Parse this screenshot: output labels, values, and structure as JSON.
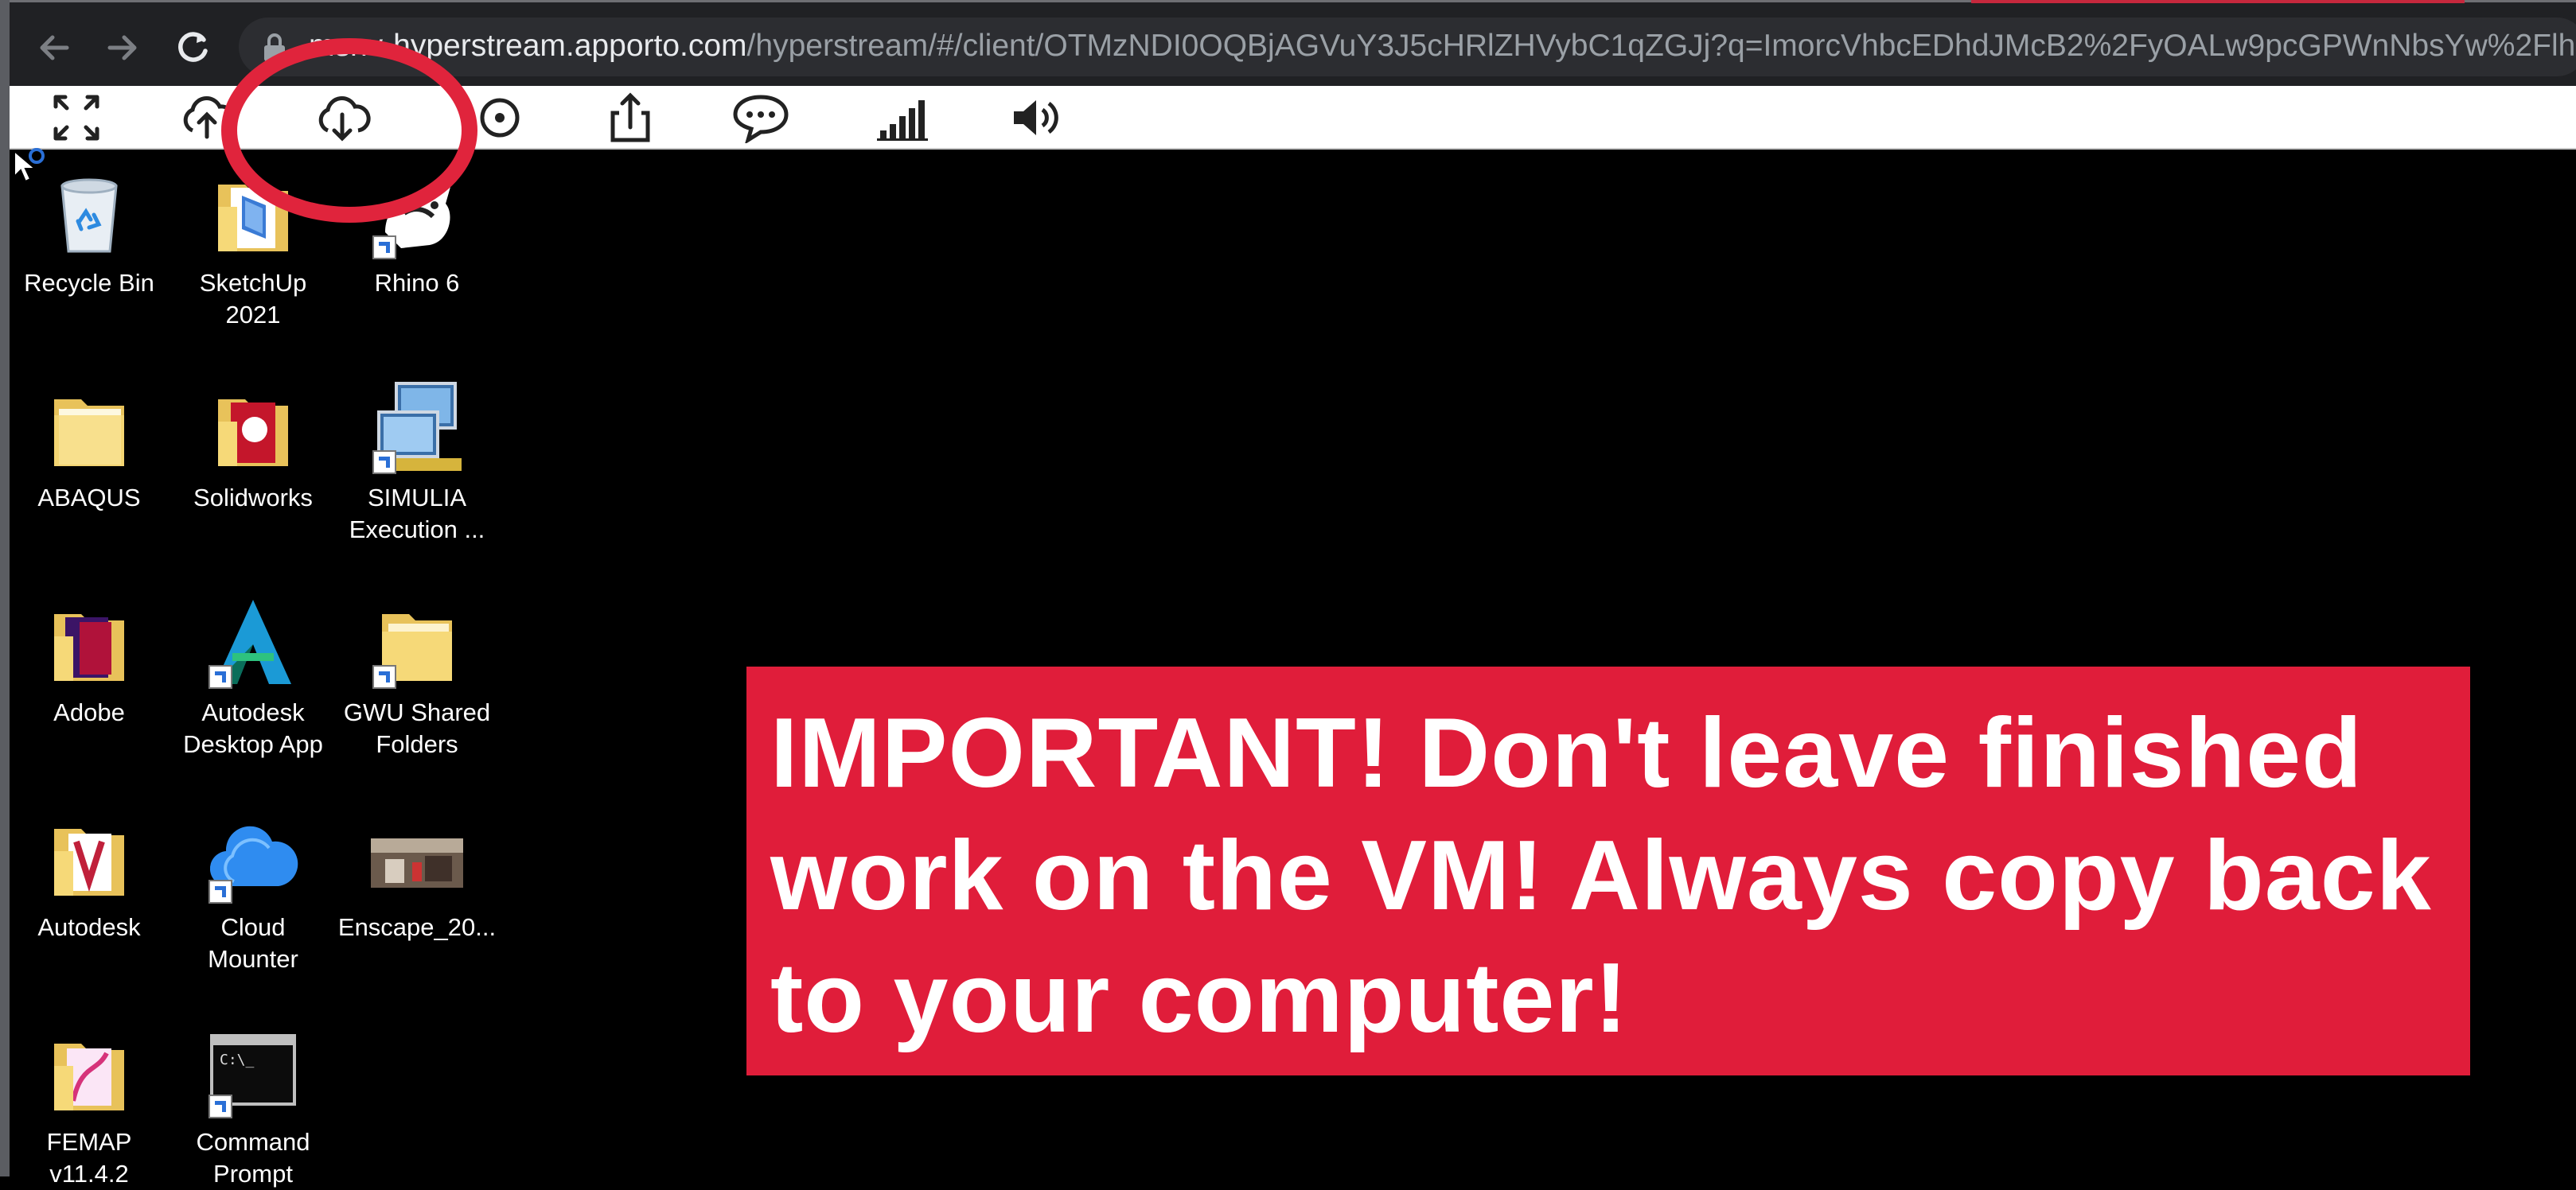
{
  "browser": {
    "url_host": "msnv-hyperstream.apporto.com",
    "url_path": "/hyperstream/#/client/OTMzNDI0OQBjAGVuY3J5cHRlZHVybC1qZGJj?q=ImorcVhbcEDhdJMcB2%2FyOALw9pcGPWnNbsYw%2Flh",
    "nav_icons": [
      "back-arrow-icon",
      "forward-arrow-icon",
      "reload-icon",
      "lock-icon"
    ]
  },
  "toolbar": {
    "icons": [
      "fullscreen-icon",
      "upload-cloud-icon",
      "download-cloud-icon",
      "record-icon",
      "share-icon",
      "chat-icon",
      "signal-icon",
      "volume-icon"
    ]
  },
  "desktop": {
    "icons": [
      {
        "id": "recycle-bin",
        "label": "Recycle Bin",
        "icon": "recycle-bin-icon"
      },
      {
        "id": "sketchup",
        "label": "SketchUp 2021",
        "icon": "sketchup-icon"
      },
      {
        "id": "rhino",
        "label": "Rhino 6",
        "icon": "rhino-icon"
      },
      {
        "id": "abaqus",
        "label": "ABAQUS",
        "icon": "folder-icon"
      },
      {
        "id": "solidworks",
        "label": "Solidworks",
        "icon": "folder-icon"
      },
      {
        "id": "simulia",
        "label": "SIMULIA Execution ...",
        "icon": "computer-icon"
      },
      {
        "id": "adobe",
        "label": "Adobe",
        "icon": "folder-icon"
      },
      {
        "id": "autodesk-desktop",
        "label": "Autodesk Desktop App",
        "icon": "autodesk-icon"
      },
      {
        "id": "gwu-shared",
        "label": "GWU Shared Folders",
        "icon": "folder-icon"
      },
      {
        "id": "autodesk",
        "label": "Autodesk",
        "icon": "folder-icon"
      },
      {
        "id": "cloud-mounter",
        "label": "Cloud Mounter",
        "icon": "cloud-icon"
      },
      {
        "id": "enscape",
        "label": "Enscape_20...",
        "icon": "image-file-icon"
      },
      {
        "id": "femap",
        "label": "FEMAP v11.4.2",
        "icon": "folder-icon"
      },
      {
        "id": "command-prompt",
        "label": "Command Prompt",
        "icon": "terminal-icon"
      }
    ]
  },
  "notice": {
    "text": "IMPORTANT! Don't leave finished work on the VM! Always copy back to your computer!",
    "background": "#e01d3a"
  },
  "colors": {
    "highlight": "#e0243c",
    "desktop_bg": "#000000",
    "toolbar_bg": "#ffffff"
  }
}
